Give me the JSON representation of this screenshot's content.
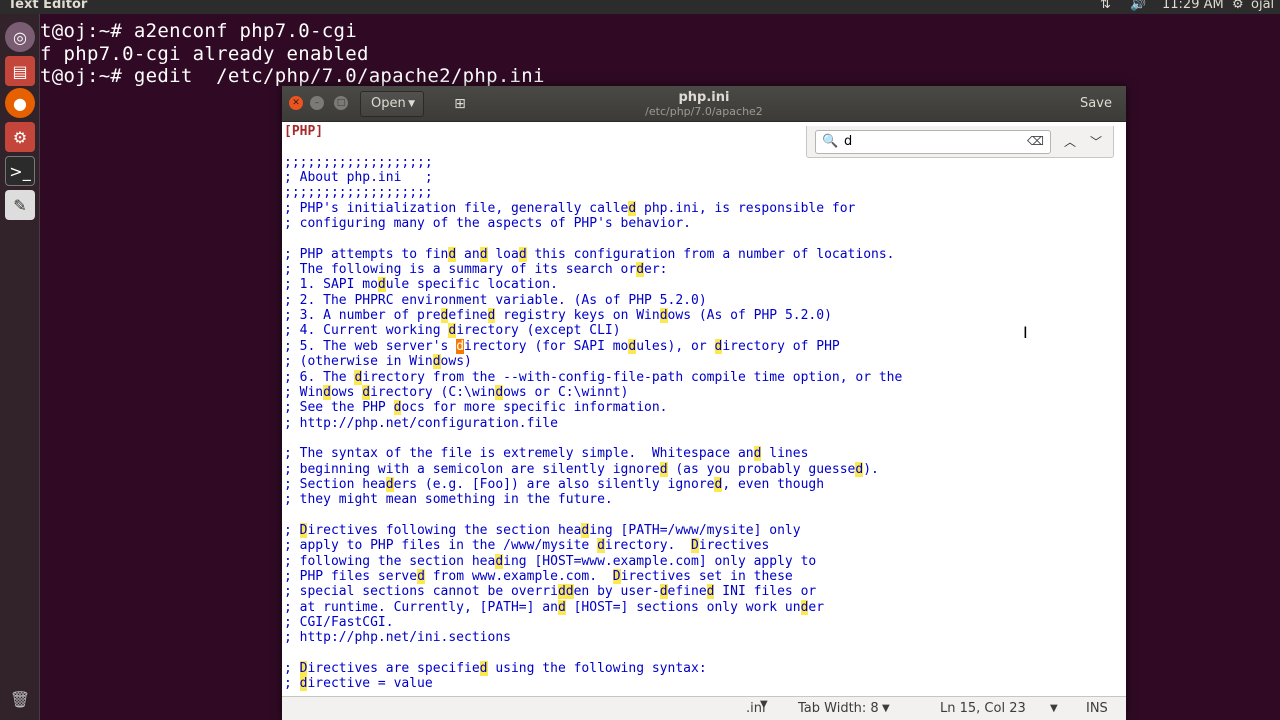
{
  "top_panel": {
    "app_title": "Text Editor",
    "time": "11:29 AM",
    "user": "ojal",
    "network_icon": "network-arrows-icon",
    "sound_icon": "speaker-icon",
    "power_icon": "gear-icon"
  },
  "terminal": {
    "lines": [
      "t@oj:~# a2enconf php7.0-cgi",
      "f php7.0-cgi already enabled",
      "t@oj:~# gedit  /etc/php/7.0/apache2/php.ini"
    ]
  },
  "launcher": {
    "items": [
      "dash-icon",
      "files-icon",
      "firefox-icon",
      "settings-icon",
      "terminal-icon",
      "text-editor-icon",
      "trash-icon"
    ]
  },
  "gedit": {
    "open_label": "Open",
    "title": "php.ini",
    "path": "/etc/php/7.0/apache2",
    "save_label": "Save",
    "search": {
      "value": "d"
    },
    "status": {
      "language": ".ini",
      "tab_width": "Tab Width: 8",
      "position": "Ln 15, Col 23",
      "mode": "INS"
    },
    "lines": [
      "[PHP]",
      "",
      ";;;;;;;;;;;;;;;;;;;",
      "; About php.ini   ;",
      ";;;;;;;;;;;;;;;;;;;",
      "; PHP's initialization file, generally called php.ini, is responsible for",
      "; configuring many of the aspects of PHP's behavior.",
      "",
      "; PHP attempts to find and load this configuration from a number of locations.",
      "; The following is a summary of its search order:",
      "; 1. SAPI module specific location.",
      "; 2. The PHPRC environment variable. (As of PHP 5.2.0)",
      "; 3. A number of predefined registry keys on Windows (As of PHP 5.2.0)",
      "; 4. Current working directory (except CLI)",
      "; 5. The web server's directory (for SAPI modules), or directory of PHP",
      "; (otherwise in Windows)",
      "; 6. The directory from the --with-config-file-path compile time option, or the",
      "; Windows directory (C:\\windows or C:\\winnt)",
      "; See the PHP docs for more specific information.",
      "; http://php.net/configuration.file",
      "",
      "; The syntax of the file is extremely simple.  Whitespace and lines",
      "; beginning with a semicolon are silently ignored (as you probably guessed).",
      "; Section headers (e.g. [Foo]) are also silently ignored, even though",
      "; they might mean something in the future.",
      "",
      "; Directives following the section heading [PATH=/www/mysite] only",
      "; apply to PHP files in the /www/mysite directory.  Directives",
      "; following the section heading [HOST=www.example.com] only apply to",
      "; PHP files served from www.example.com.  Directives set in these",
      "; special sections cannot be overridden by user-defined INI files or",
      "; at runtime. Currently, [PATH=] and [HOST=] sections only work under",
      "; CGI/FastCGI.",
      "; http://php.net/ini.sections",
      "",
      "; Directives are specified using the following syntax:",
      "; directive = value"
    ],
    "current_match": {
      "line": 14,
      "col": 22
    }
  }
}
